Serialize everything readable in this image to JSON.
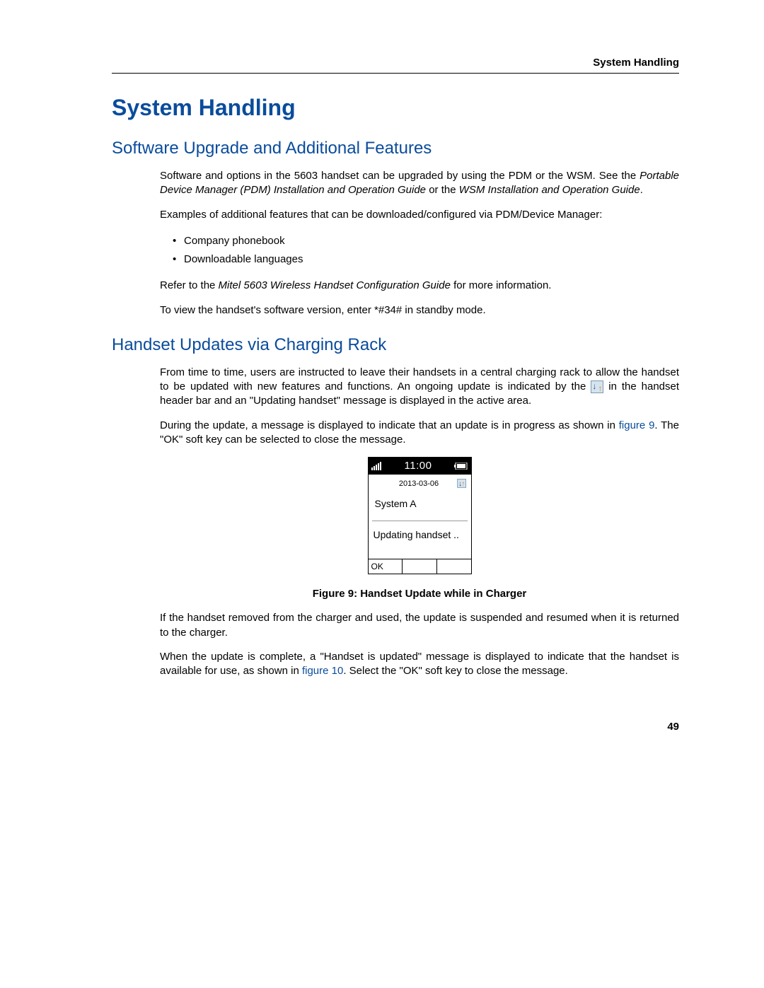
{
  "header": {
    "running": "System Handling"
  },
  "title": "System Handling",
  "section1": {
    "heading": "Software Upgrade and Additional Features",
    "p1a": "Software and options in the 5603 handset can be upgraded by using the PDM or the WSM. See the ",
    "p1i1": "Portable Device Manager (PDM) Installation and Operation Guide",
    "p1b": " or the ",
    "p1i2": "WSM Installation and Operation Guide",
    "p1c": ".",
    "p2": "Examples of additional features that can be downloaded/configured via PDM/Device Manager:",
    "bullets": [
      "Company phonebook",
      "Downloadable languages"
    ],
    "p3a": "Refer to the ",
    "p3i": "Mitel 5603 Wireless Handset Configuration Guide",
    "p3b": " for more information.",
    "p4": "To view the handset's software version, enter *#34# in standby mode."
  },
  "section2": {
    "heading": "Handset Updates via Charging Rack",
    "p1a": "From time to time, users are instructed to leave their handsets in a central charging rack to allow the handset to be updated with new features and functions. An ongoing update is indicated by the ",
    "p1b": " in the handset header bar and an \"Updating handset\" message is displayed in the active area.",
    "p2a": "During the update, a message is displayed to indicate that an update is in progress as shown in ",
    "p2xref": "figure 9",
    "p2b": ". The \"OK\" soft key can be selected to close the message.",
    "phone": {
      "time": "11:00",
      "date": "2013-03-06",
      "system": "System A",
      "message": "Updating handset ..",
      "softkeys": [
        "OK",
        "",
        ""
      ]
    },
    "caption": "Figure 9: Handset Update while in Charger",
    "p3": "If the handset removed from the charger and used, the update is suspended and resumed when it is returned to the charger.",
    "p4a": "When the update is complete, a \"Handset is updated\" message is displayed to indicate that the handset is available for use, as shown in ",
    "p4xref": "figure 10",
    "p4b": ". Select the \"OK\" soft key to close the message."
  },
  "page_number": "49"
}
